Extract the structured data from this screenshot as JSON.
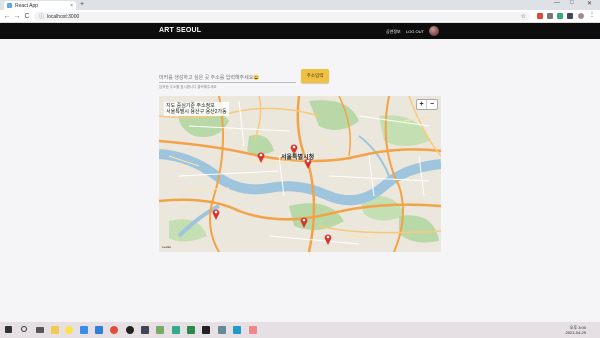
{
  "browser": {
    "tab_title": "React App",
    "tab_close": "×",
    "new_tab": "+",
    "url": "localhost:3000",
    "back": "←",
    "forward": "→",
    "reload": "C",
    "home": "⌂",
    "star": "☆",
    "win_min": "—",
    "win_max": "□",
    "win_close": "✕"
  },
  "header": {
    "brand": "ART SEOUL",
    "nav": [
      "공연정보",
      "LOG OUT"
    ]
  },
  "search": {
    "placeholder": "마커를 생성하고 싶은 곳 주소를 입력해주세요😀",
    "button_label": "주소입력",
    "helper_text": "입력한 주소를 표시합니다 클릭해주세요"
  },
  "map": {
    "info_lines": [
      "지도 중심기준 주소정보",
      "서울특별시 용산구 용산2가동"
    ],
    "city_label": "서울특별시청",
    "zoom_in": "+",
    "zoom_out": "−",
    "scale_label": "Leaflet"
  },
  "taskbar": {
    "time": "오후 3:00",
    "date": "2021-04-29"
  },
  "colors": {
    "header_bg": "#0d0d0d",
    "button_bg": "#f0c040",
    "marker": "#d9342b",
    "river": "#9ec5dd"
  }
}
